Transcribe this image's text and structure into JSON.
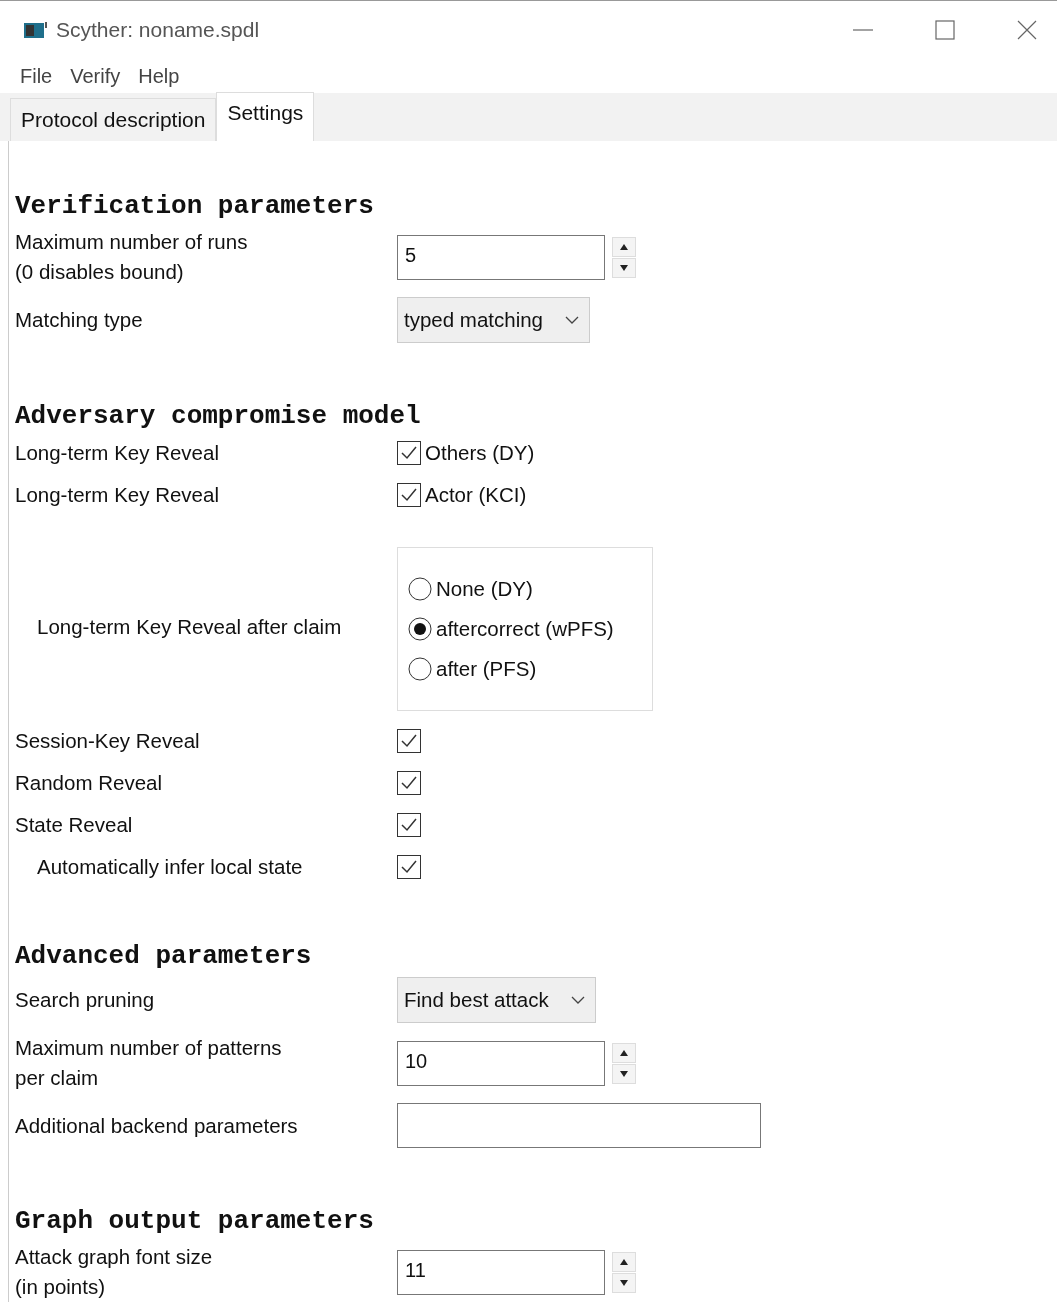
{
  "window": {
    "title": "Scyther: noname.spdl"
  },
  "menu": [
    "File",
    "Verify",
    "Help"
  ],
  "tabs": [
    {
      "label": "Protocol description",
      "selected": false
    },
    {
      "label": "Settings",
      "selected": true
    }
  ],
  "sections": [
    {
      "heading": "Verification parameters",
      "rows": [
        {
          "kind": "spin",
          "label": "Maximum number of runs\n(0 disables bound)",
          "value": "5"
        },
        {
          "kind": "select",
          "label": "Matching type",
          "value": "typed matching"
        }
      ]
    },
    {
      "heading": "Adversary compromise model",
      "rows": [
        {
          "kind": "check",
          "label": "Long-term Key Reveal",
          "text": "Others (DY)",
          "checked": true
        },
        {
          "kind": "check",
          "label": "Long-term Key Reveal",
          "text": "Actor (KCI)",
          "checked": true
        },
        {
          "kind": "radio",
          "label": "Long-term Key Reveal after claim",
          "indented": true,
          "options": [
            {
              "label": "None (DY)",
              "selected": false
            },
            {
              "label": "aftercorrect (wPFS)",
              "selected": true
            },
            {
              "label": "after (PFS)",
              "selected": false
            }
          ]
        },
        {
          "kind": "check",
          "label": "Session-Key Reveal",
          "checked": true
        },
        {
          "kind": "check",
          "label": "Random Reveal",
          "checked": true
        },
        {
          "kind": "check",
          "label": "State Reveal",
          "checked": true
        },
        {
          "kind": "check",
          "label": "Automatically infer local state",
          "checked": true,
          "indented": true
        }
      ]
    },
    {
      "heading": "Advanced parameters",
      "rows": [
        {
          "kind": "select",
          "label": "Search pruning",
          "value": "Find best attack"
        },
        {
          "kind": "spin",
          "label": "Maximum number of patterns\nper claim",
          "value": "10"
        },
        {
          "kind": "text",
          "label": "Additional backend parameters"
        }
      ]
    },
    {
      "heading": "Graph output parameters",
      "rows": [
        {
          "kind": "spin",
          "label": "Attack graph font size\n(in points)",
          "value": "11"
        }
      ]
    }
  ]
}
